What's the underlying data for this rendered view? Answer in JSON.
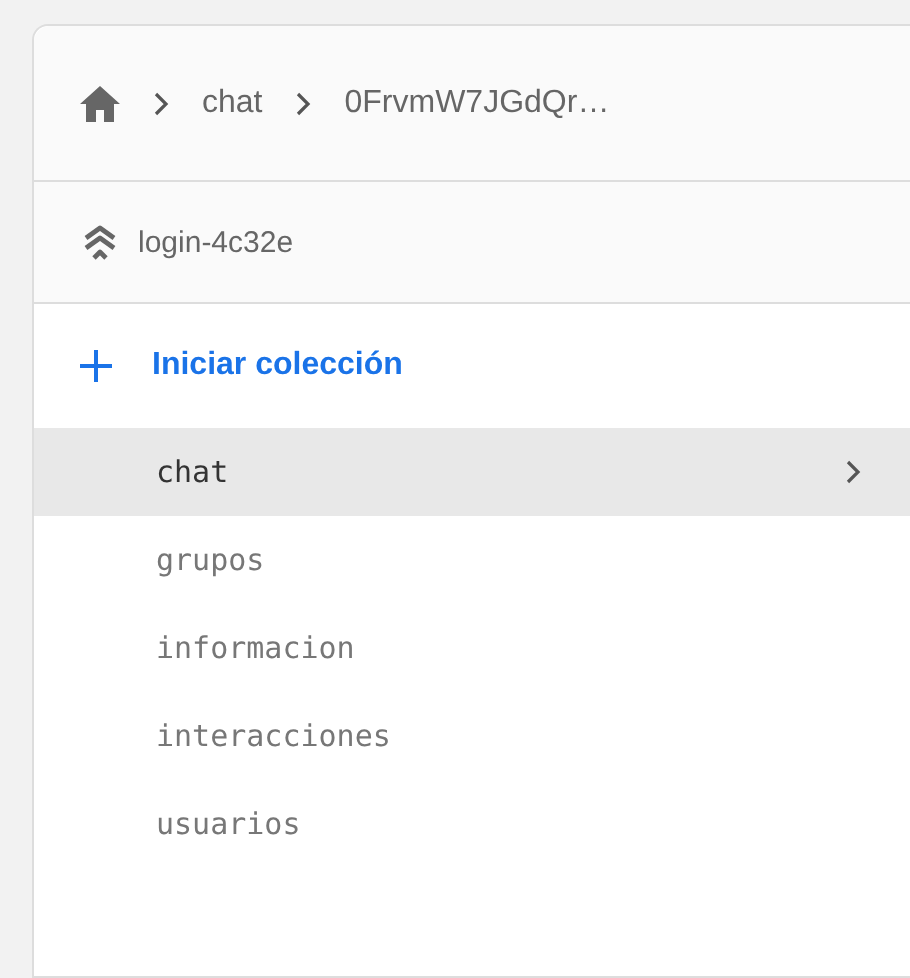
{
  "breadcrumb": [
    {
      "kind": "home"
    },
    {
      "kind": "text",
      "label": "chat"
    },
    {
      "kind": "text",
      "label": "0FrvmW7JGdQr…"
    }
  ],
  "project": {
    "name": "login-4c32e"
  },
  "add_collection": {
    "label": "Iniciar colección"
  },
  "collections": [
    {
      "name": "chat",
      "selected": true
    },
    {
      "name": "grupos",
      "selected": false
    },
    {
      "name": "informacion",
      "selected": false
    },
    {
      "name": "interacciones",
      "selected": false
    },
    {
      "name": "usuarios",
      "selected": false
    }
  ]
}
